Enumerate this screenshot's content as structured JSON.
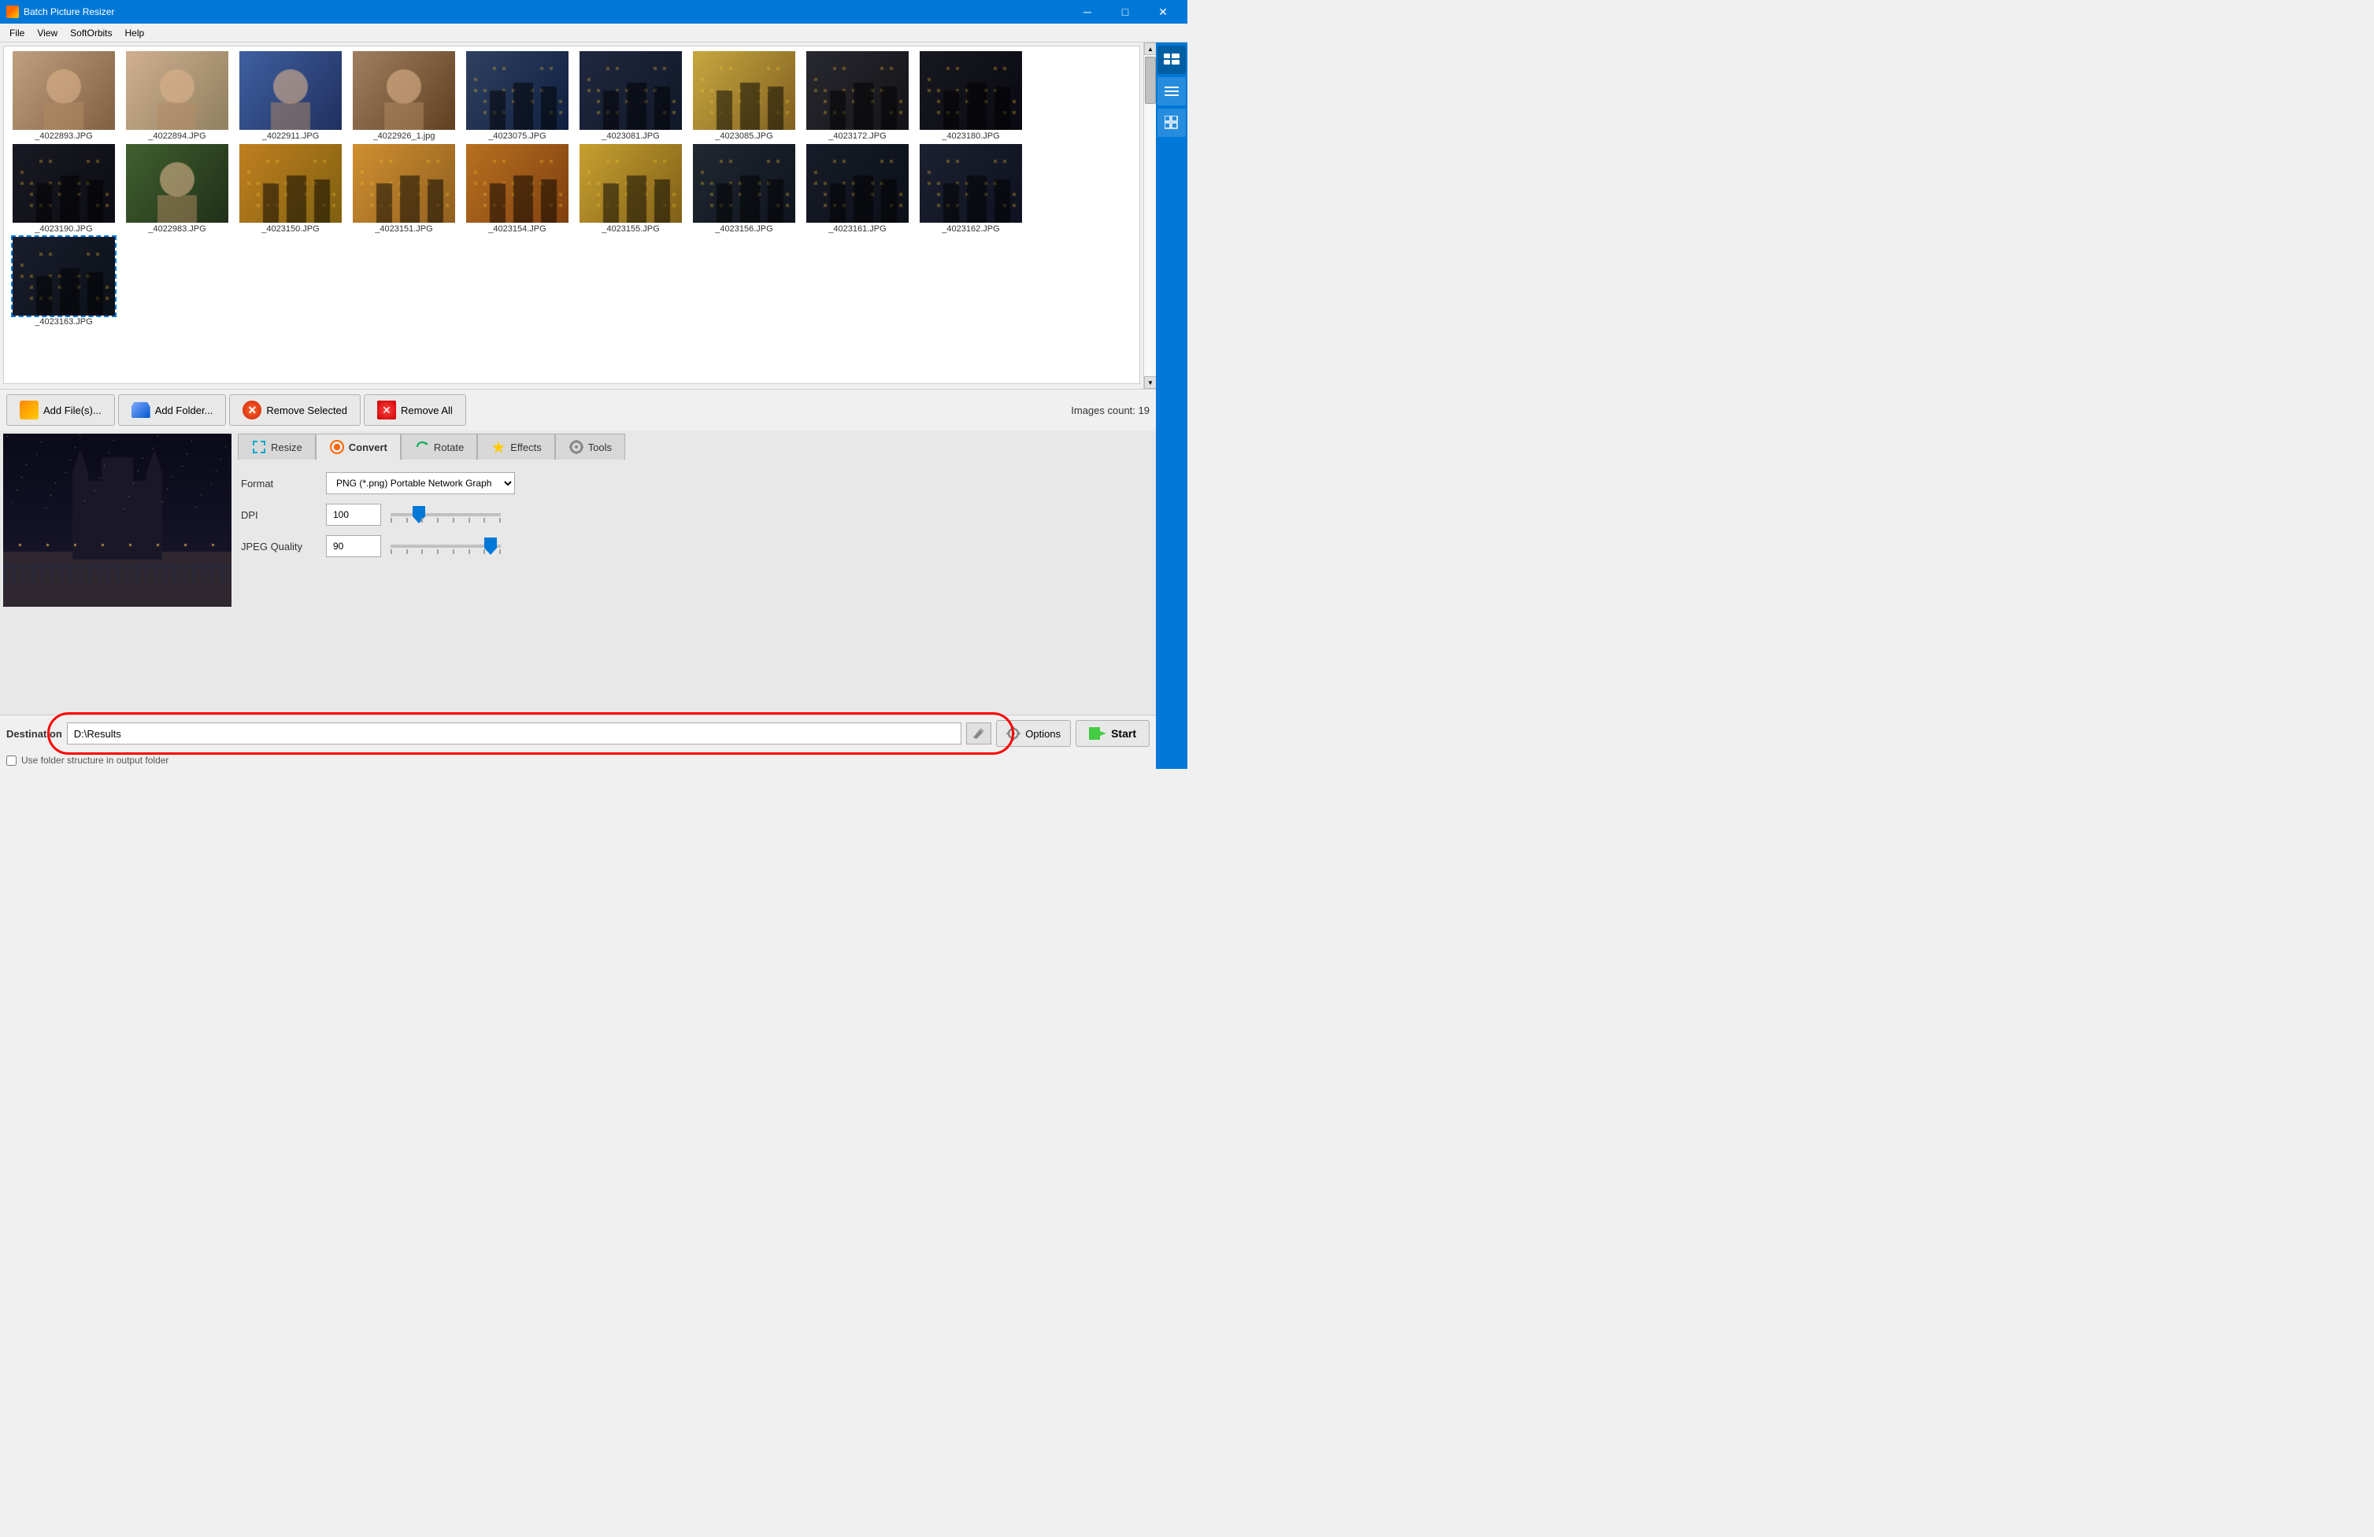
{
  "app": {
    "title": "Batch Picture Resizer",
    "title_full": "Batch Picture Resizer"
  },
  "titlebar": {
    "minimize": "─",
    "maximize": "□",
    "close": "✕"
  },
  "menu": {
    "items": [
      "File",
      "View",
      "SoftOrbits",
      "Help"
    ]
  },
  "toolbar": {
    "add_files": "Add File(s)...",
    "add_folder": "Add Folder...",
    "remove_selected": "Remove Selected",
    "remove_all": "Remove All",
    "images_count_label": "Images count:",
    "images_count": "19"
  },
  "thumbnails": [
    {
      "id": "t1",
      "name": "_4022893.JPG",
      "cls": "img-person1"
    },
    {
      "id": "t2",
      "name": "_4022894.JPG",
      "cls": "img-person2"
    },
    {
      "id": "t3",
      "name": "_4022911.JPG",
      "cls": "img-table"
    },
    {
      "id": "t4",
      "name": "_4022926_1.jpg",
      "cls": "img-person3"
    },
    {
      "id": "t5",
      "name": "_4023075.JPG",
      "cls": "img-street1"
    },
    {
      "id": "t6",
      "name": "_4023081.JPG",
      "cls": "img-street2"
    },
    {
      "id": "t7",
      "name": "_4023085.JPG",
      "cls": "img-building1"
    },
    {
      "id": "t8",
      "name": "_4023172.JPG",
      "cls": "img-night1"
    },
    {
      "id": "t9",
      "name": "_4023180.JPG",
      "cls": "img-night2"
    },
    {
      "id": "t10",
      "name": "_4023190.JPG",
      "cls": "img-night3"
    },
    {
      "id": "t11",
      "name": "_4022983.JPG",
      "cls": "img-couple"
    },
    {
      "id": "t12",
      "name": "_4023150.JPG",
      "cls": "img-street3"
    },
    {
      "id": "t13",
      "name": "_4023151.JPG",
      "cls": "img-street4"
    },
    {
      "id": "t14",
      "name": "_4023154.JPG",
      "cls": "img-street5"
    },
    {
      "id": "t15",
      "name": "_4023155.JPG",
      "cls": "img-church1"
    },
    {
      "id": "t16",
      "name": "_4023156.JPG",
      "cls": "img-church2"
    },
    {
      "id": "t17",
      "name": "_4023161.JPG",
      "cls": "img-church3"
    },
    {
      "id": "t18",
      "name": "_4023162.JPG",
      "cls": "img-church4"
    },
    {
      "id": "t19",
      "name": "_4023163.JPG",
      "cls": "img-church5",
      "selected": true
    }
  ],
  "tabs": [
    {
      "id": "resize",
      "label": "Resize"
    },
    {
      "id": "convert",
      "label": "Convert",
      "active": true
    },
    {
      "id": "rotate",
      "label": "Rotate"
    },
    {
      "id": "effects",
      "label": "Effects"
    },
    {
      "id": "tools",
      "label": "Tools"
    }
  ],
  "convert": {
    "format_label": "Format",
    "format_value": "PNG (*.png) Portable Network Graph",
    "dpi_label": "DPI",
    "dpi_value": "100",
    "jpeg_quality_label": "JPEG Quality",
    "jpeg_quality_value": "90"
  },
  "destination": {
    "label": "Destination",
    "value": "D:\\Results",
    "placeholder": "D:\\Results"
  },
  "buttons": {
    "options": "Options",
    "start": "Start"
  },
  "checkbox": {
    "label": "Use folder structure in output folder"
  },
  "sidebar": {
    "buttons": [
      "🖼",
      "☰",
      "▦"
    ]
  }
}
